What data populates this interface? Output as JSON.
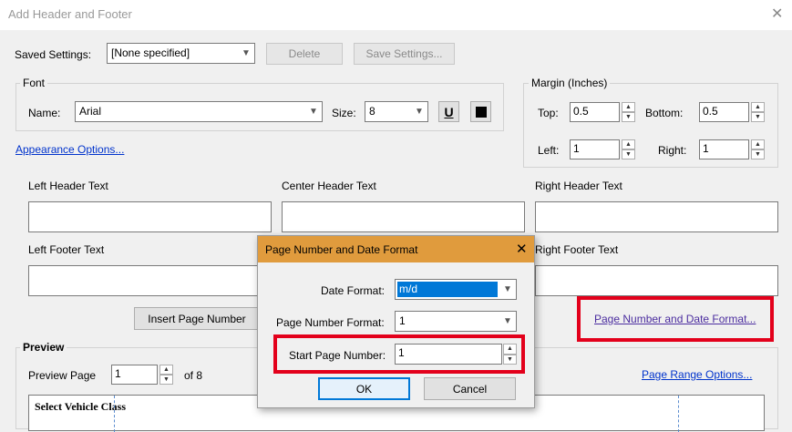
{
  "window": {
    "title": "Add Header and Footer"
  },
  "saved_settings": {
    "label": "Saved Settings:",
    "value": "[None specified]",
    "delete_label": "Delete",
    "save_label": "Save Settings..."
  },
  "font": {
    "group_title": "Font",
    "name_label": "Name:",
    "name_value": "Arial",
    "size_label": "Size:",
    "size_value": "8",
    "underline_label": "U"
  },
  "margin": {
    "group_title": "Margin (Inches)",
    "top_label": "Top:",
    "top_value": "0.5",
    "bottom_label": "Bottom:",
    "bottom_value": "0.5",
    "left_label": "Left:",
    "left_value": "1",
    "right_label": "Right:",
    "right_value": "1"
  },
  "appearance_link": "Appearance Options...",
  "header_fields": {
    "left": "Left Header Text",
    "center": "Center Header Text",
    "right": "Right Header Text"
  },
  "footer_fields": {
    "left": "Left Footer Text",
    "right": "Right Footer Text"
  },
  "insert_page_number": "Insert Page Number",
  "page_number_date_link": "Page Number and Date Format...",
  "preview": {
    "title": "Preview",
    "page_label": "Preview Page",
    "page_value": "1",
    "of_label": "of 8",
    "range_link": "Page Range Options...",
    "content_text": "Select Vehicle Class"
  },
  "dialog": {
    "title": "Page Number and Date Format",
    "date_format_label": "Date Format:",
    "date_format_value": "m/d",
    "page_number_format_label": "Page Number Format:",
    "page_number_format_value": "1",
    "start_page_label": "Start Page Number:",
    "start_page_value": "1",
    "ok_label": "OK",
    "cancel_label": "Cancel"
  },
  "colors": {
    "dialog_titlebar": "#e09b3d",
    "highlight": "#e3001b",
    "link": "#0033cc",
    "selection": "#0078d7"
  }
}
